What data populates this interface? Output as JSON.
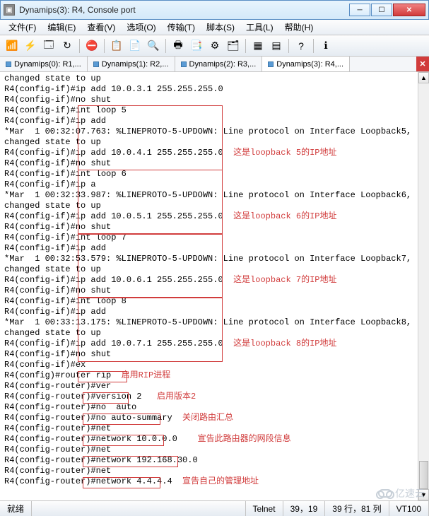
{
  "window": {
    "title": "Dynamips(3): R4, Console port"
  },
  "menu": {
    "file": "文件(F)",
    "edit": "编辑(E)",
    "view": "查看(V)",
    "options": "选项(O)",
    "transfer": "传输(T)",
    "script": "脚本(S)",
    "tools": "工具(L)",
    "help": "帮助(H)"
  },
  "tabs": {
    "t0": "Dynamips(0): R1,...",
    "t1": "Dynamips(1): R2,...",
    "t2": "Dynamips(2): R3,...",
    "t3": "Dynamips(3): R4,..."
  },
  "terminal": {
    "lines": [
      "changed state to up",
      "R4(config-if)#ip add 10.0.3.1 255.255.255.0",
      "R4(config-if)#no shut",
      "R4(config-if)#int loop 5",
      "R4(config-if)#ip add",
      "*Mar  1 00:32:07.763: %LINEPROTO-5-UPDOWN: Line protocol on Interface Loopback5,",
      "changed state to up",
      "R4(config-if)#ip add 10.0.4.1 255.255.255.0  这是loopback 5的IP地址",
      "R4(config-if)#no shut",
      "R4(config-if)#int loop 6",
      "R4(config-if)#ip a",
      "*Mar  1 00:32:33.987: %LINEPROTO-5-UPDOWN: Line protocol on Interface Loopback6,",
      "changed state to up",
      "R4(config-if)#ip add 10.0.5.1 255.255.255.0  这是loopback 6的IP地址",
      "R4(config-if)#no shut",
      "R4(config-if)#int loop 7",
      "R4(config-if)#ip add",
      "*Mar  1 00:32:53.579: %LINEPROTO-5-UPDOWN: Line protocol on Interface Loopback7,",
      "changed state to up",
      "R4(config-if)#ip add 10.0.6.1 255.255.255.0  这是loopback 7的IP地址",
      "R4(config-if)#no shut",
      "R4(config-if)#int loop 8",
      "R4(config-if)#ip add",
      "*Mar  1 00:33:13.175: %LINEPROTO-5-UPDOWN: Line protocol on Interface Loopback8,",
      "changed state to up",
      "R4(config-if)#ip add 10.0.7.1 255.255.255.0  这是loopback 8的IP地址",
      "R4(config-if)#no shut",
      "R4(config-if)#ex",
      "R4(config)#router rip  启用RIP进程",
      "R4(config-router)#ver",
      "R4(config-router)#version 2   启用版本2",
      "R4(config-router)#no  auto",
      "R4(config-router)#no auto-summary  关闭路由汇总",
      "R4(config-router)#net",
      "R4(config-router)#network 10.0.0.0    宣告此路由器的网段信息",
      "R4(config-router)#net",
      "R4(config-router)#network 192.168.30.0",
      "R4(config-router)#net",
      "R4(config-router)#network 4.4.4.4  宣告自己的管理地址"
    ],
    "ann_indices": [
      7,
      13,
      19,
      25,
      28,
      30,
      32,
      34,
      38
    ],
    "ann_splits": {
      "7": [
        "R4(config-if)#ip add 10.0.4.1 255.255.255.0  ",
        "这是loopback 5的IP地址"
      ],
      "13": [
        "R4(config-if)#ip add 10.0.5.1 255.255.255.0  ",
        "这是loopback 6的IP地址"
      ],
      "19": [
        "R4(config-if)#ip add 10.0.6.1 255.255.255.0  ",
        "这是loopback 7的IP地址"
      ],
      "25": [
        "R4(config-if)#ip add 10.0.7.1 255.255.255.0  ",
        "这是loopback 8的IP地址"
      ],
      "28": [
        "R4(config)#router rip  ",
        "启用RIP进程"
      ],
      "30": [
        "R4(config-router)#version 2   ",
        "启用版本2"
      ],
      "32": [
        "R4(config-router)#no auto-summary  ",
        "关闭路由汇总"
      ],
      "34": [
        "R4(config-router)#network 10.0.0.0    ",
        "宣告此路由器的网段信息"
      ],
      "38": [
        "R4(config-router)#network 4.4.4.4  ",
        "宣告自己的管理地址"
      ]
    }
  },
  "status": {
    "ready": "就绪",
    "proto": "Telnet",
    "pos": "39，19",
    "size": "39 行，81 列",
    "emul": "VT100"
  },
  "watermark": "亿速云"
}
